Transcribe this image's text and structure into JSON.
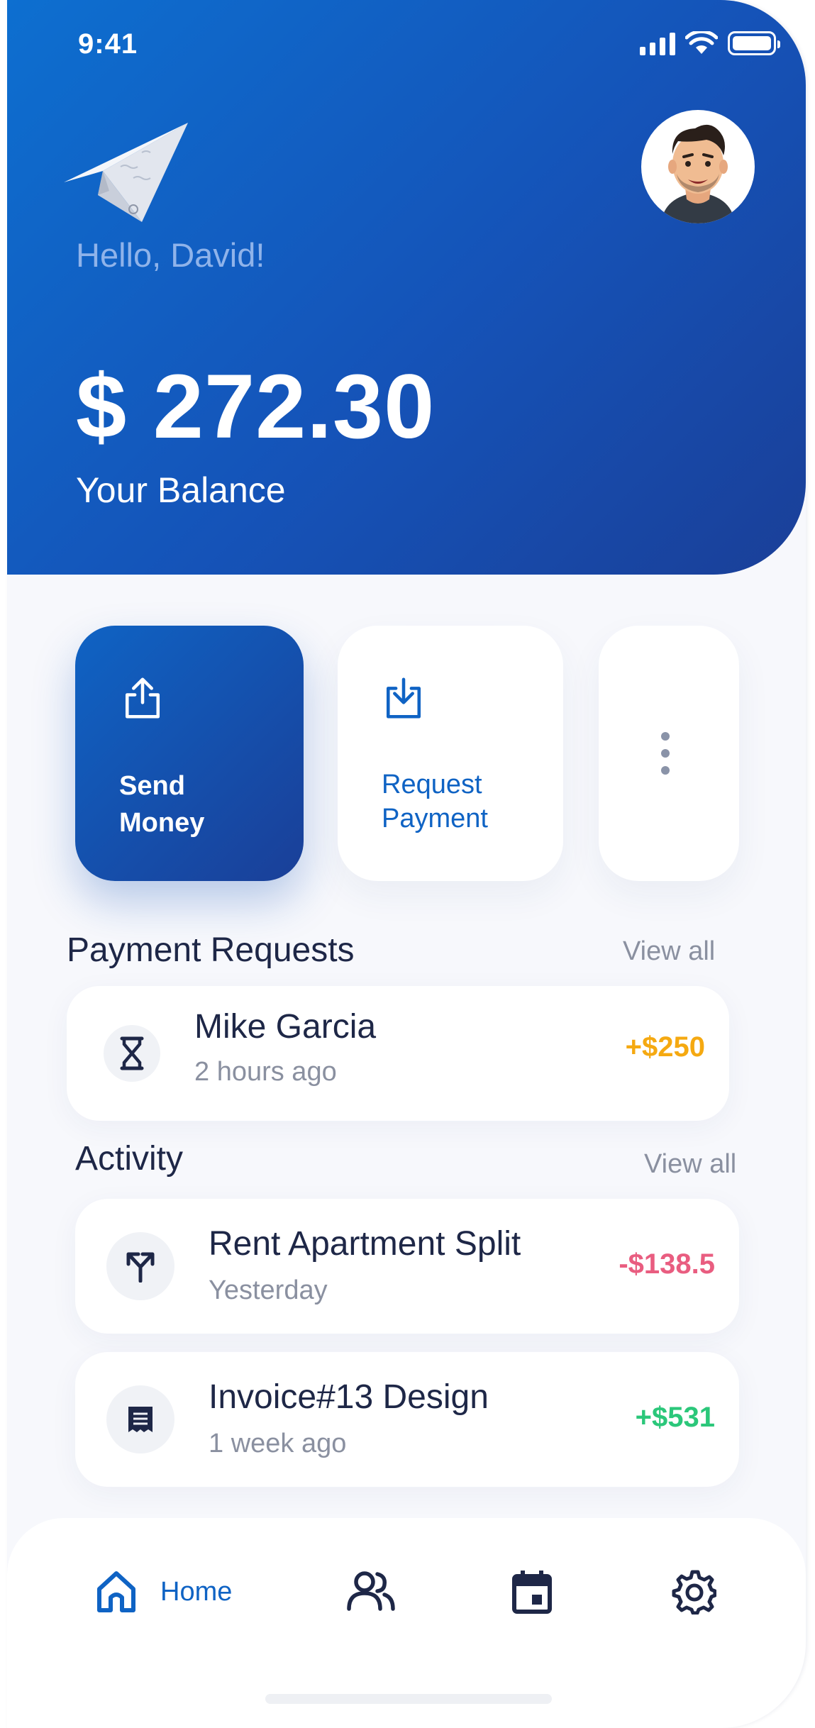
{
  "status_bar": {
    "time": "9:41"
  },
  "header": {
    "greeting": "Hello, David!",
    "balance": "$ 272.30",
    "balance_label": "Your Balance"
  },
  "actions": {
    "send_line1": "Send",
    "send_line2": "Money",
    "request_line1": "Request",
    "request_line2": "Payment"
  },
  "payment_requests": {
    "title": "Payment Requests",
    "view_all": "View all",
    "items": [
      {
        "name": "Mike Garcia",
        "time": "2 hours ago",
        "amount": "+$250",
        "icon": "hourglass-icon",
        "color": "#f5a911"
      }
    ]
  },
  "activity": {
    "title": "Activity",
    "view_all": "View all",
    "items": [
      {
        "name": "Rent Apartment Split",
        "time": "Yesterday",
        "amount": "-$138.5",
        "icon": "split-icon",
        "color": "#e95d80"
      },
      {
        "name": "Invoice#13 Design",
        "time": "1 week ago",
        "amount": "+$531",
        "icon": "receipt-icon",
        "color": "#2bc77a"
      }
    ]
  },
  "nav": {
    "home_label": "Home",
    "active": "home",
    "items": [
      "home-icon",
      "users-icon",
      "calendar-icon",
      "settings-icon"
    ]
  },
  "colors": {
    "primary": "#1553b8",
    "accent": "#0f63c4",
    "text": "#1e2747",
    "muted": "#8a90a0"
  }
}
